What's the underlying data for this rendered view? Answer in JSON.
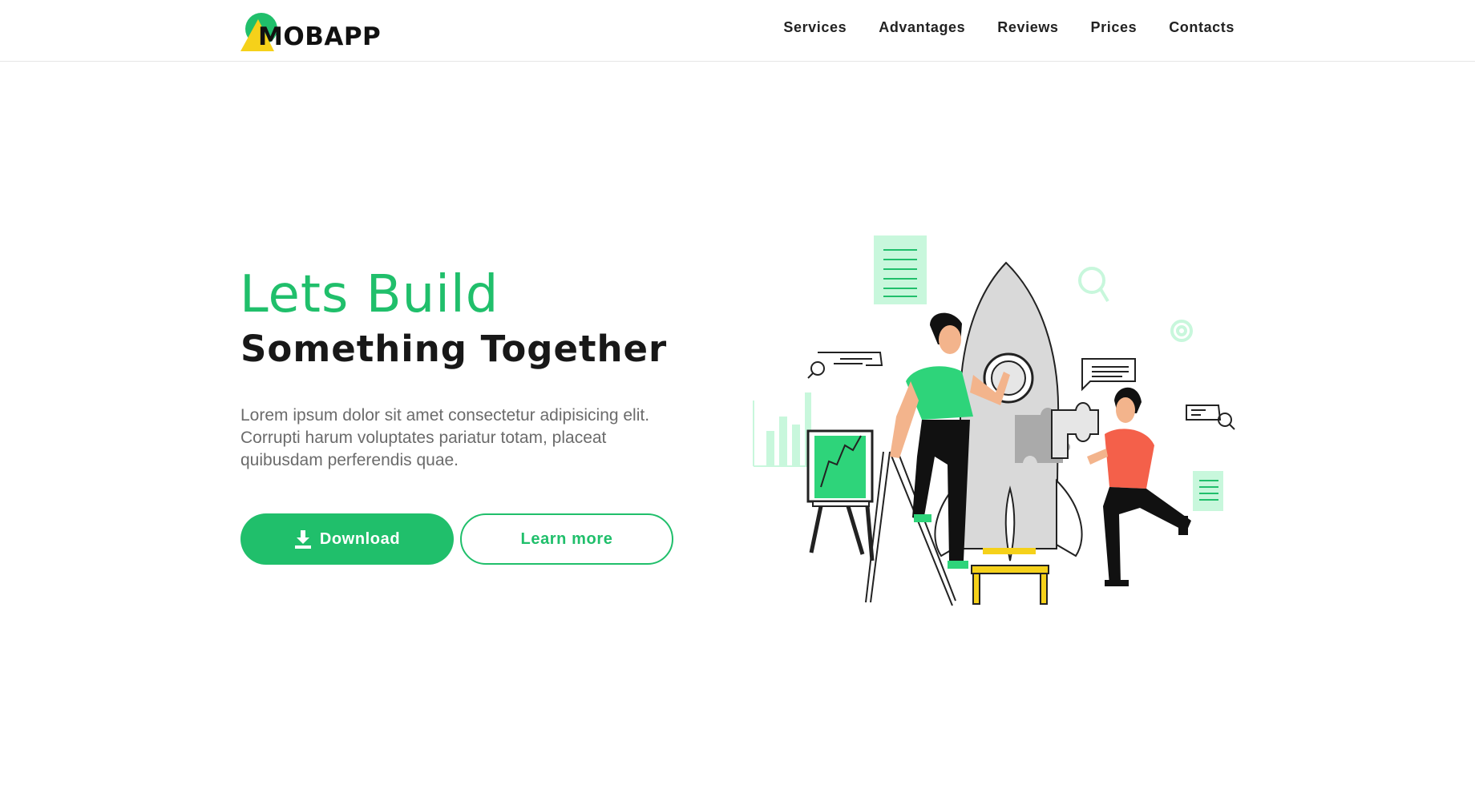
{
  "header": {
    "logo_text": "MOBAPP",
    "nav": [
      "Services",
      "Advantages",
      "Reviews",
      "Prices",
      "Contacts"
    ]
  },
  "hero": {
    "title": "Lets Build",
    "subtitle": "Something Together",
    "description": "Lorem ipsum dolor sit amet consectetur adipisicing elit. Corrupti harum voluptates pariatur totam, placeat quibusdam perferendis quae.",
    "download_label": "Download",
    "learn_more_label": "Learn more"
  },
  "colors": {
    "accent": "#20bf6b",
    "logo_yellow": "#f5d11a",
    "person_orange": "#f4604a",
    "light_green": "#c8f7dc"
  },
  "icons": {
    "download": "download-icon",
    "logo": "logo-mark-icon"
  }
}
